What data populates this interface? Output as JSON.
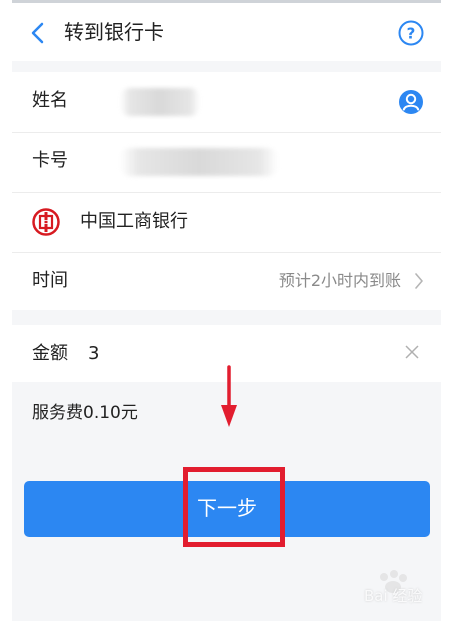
{
  "header": {
    "title": "转到银行卡"
  },
  "form": {
    "name_label": "姓名",
    "card_label": "卡号",
    "bank_name": "中国工商银行",
    "time_label": "时间",
    "time_value": "预计2小时内到账"
  },
  "amount": {
    "label": "金额",
    "value": "3"
  },
  "fee": {
    "text": "服务费0.10元"
  },
  "actions": {
    "next_label": "下一步"
  },
  "watermark": {
    "text": "Bai 经验"
  },
  "colors": {
    "accent": "#2c87f2",
    "annotation_red": "#e21d2f",
    "bank_red": "#d71a21"
  }
}
